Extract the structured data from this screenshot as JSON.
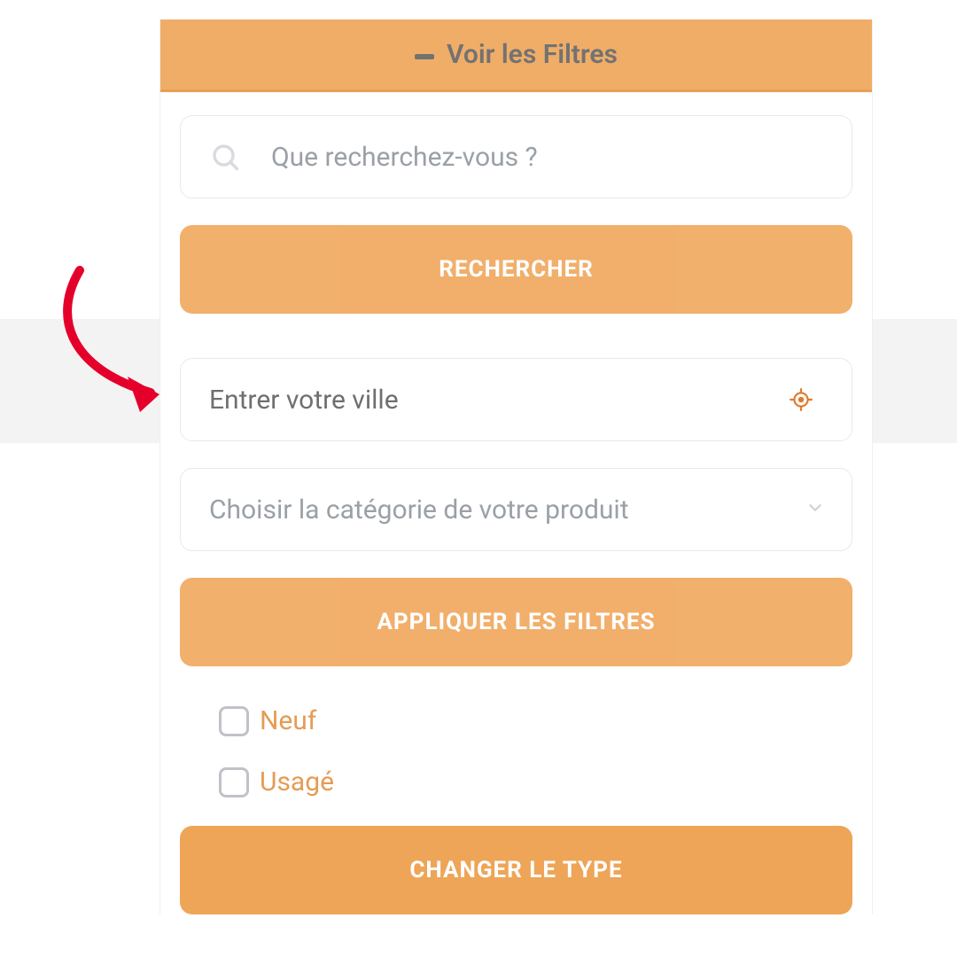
{
  "header": {
    "title": "Voir les Filtres"
  },
  "search": {
    "placeholder": "Que recherchez-vous ?",
    "button_label": "RECHERCHER"
  },
  "city": {
    "placeholder": "Entrer votre ville"
  },
  "category": {
    "placeholder": "Choisir la catégorie de votre produit"
  },
  "filters": {
    "apply_label": "APPLIQUER LES FILTRES",
    "change_type_label": "CHANGER LE TYPE",
    "options": {
      "new_label": "Neuf",
      "used_label": "Usagé"
    }
  }
}
